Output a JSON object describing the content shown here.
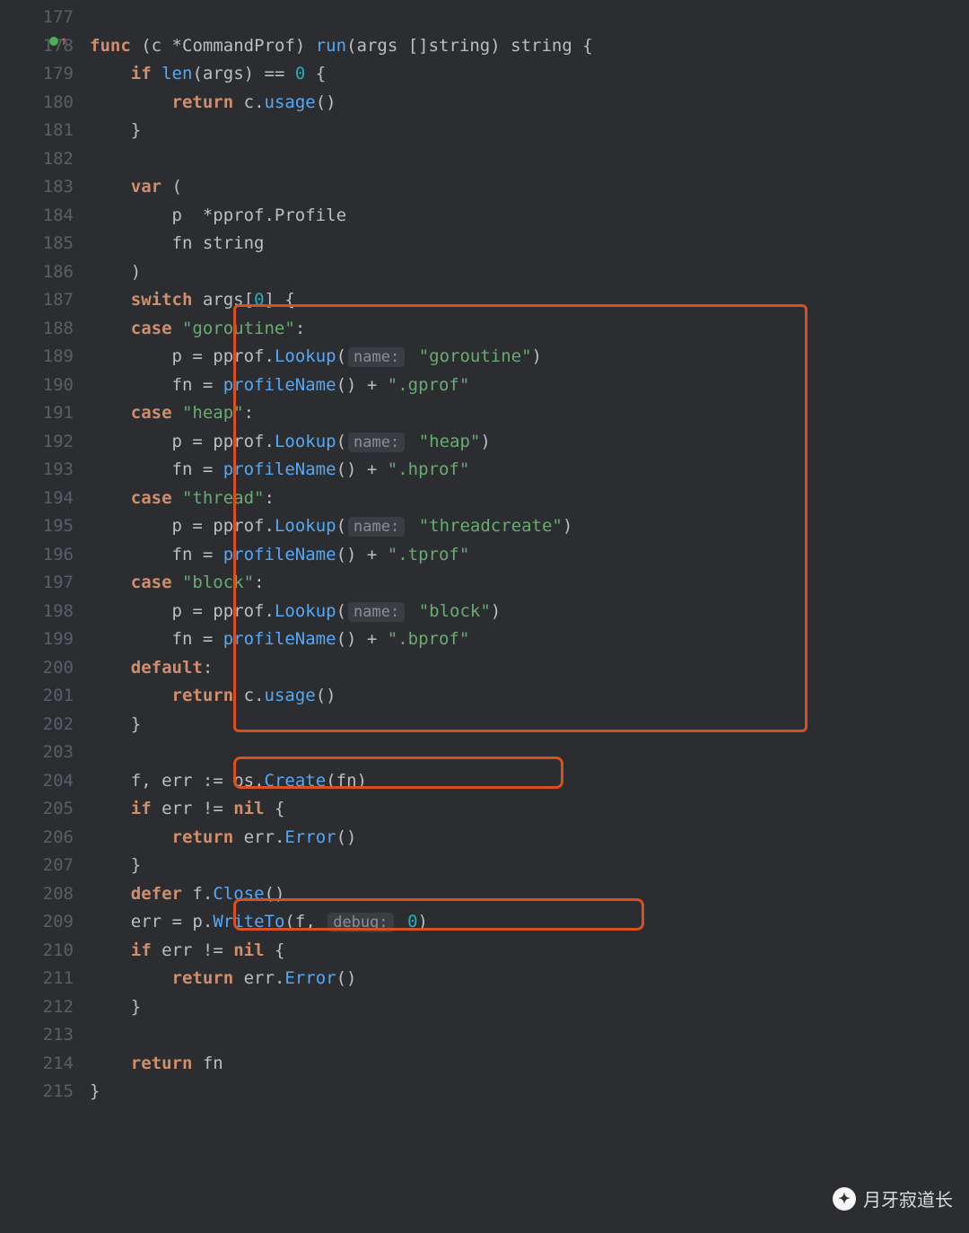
{
  "lines": {
    "start": 177,
    "end": 215
  },
  "gutter": {
    "marker_line": 178,
    "marker_kind": "modified-up"
  },
  "tokens": {
    "kw_func": "func",
    "kw_if": "if",
    "kw_return": "return",
    "kw_var": "var",
    "kw_switch": "switch",
    "kw_case": "case",
    "kw_default": "default",
    "kw_defer": "defer",
    "kw_nil": "nil",
    "id_c": "c",
    "id_len": "len",
    "id_args": "args",
    "id_p": "p",
    "id_fn": "fn",
    "id_f": "f",
    "id_err": "err",
    "type_CommandProf": "CommandProf",
    "type_string": "string",
    "type_pprof_Profile": "pprof.Profile",
    "m_run": "run",
    "m_usage": "usage",
    "m_Lookup": "Lookup",
    "m_profileName": "profileName",
    "m_Create": "Create",
    "m_Error": "Error",
    "m_Close": "Close",
    "m_WriteTo": "WriteTo",
    "pkg_pprof": "pprof",
    "pkg_os": "os",
    "str_goroutine": "\"goroutine\"",
    "str_gprof": "\".gprof\"",
    "str_heap": "\"heap\"",
    "str_hprof": "\".hprof\"",
    "str_thread": "\"thread\"",
    "str_threadcreate": "\"threadcreate\"",
    "str_tprof": "\".tprof\"",
    "str_block": "\"block\"",
    "str_bprof": "\".bprof\"",
    "num_0": "0",
    "hint_name": "name:",
    "hint_debug": "debug:"
  },
  "watermark": {
    "text": "月牙寂道长"
  },
  "highlight_boxes": [
    {
      "desc": "switch-cases",
      "lines": "188-202"
    },
    {
      "desc": "os-create-call",
      "line": 204
    },
    {
      "desc": "writeto-call",
      "line": 209
    }
  ]
}
